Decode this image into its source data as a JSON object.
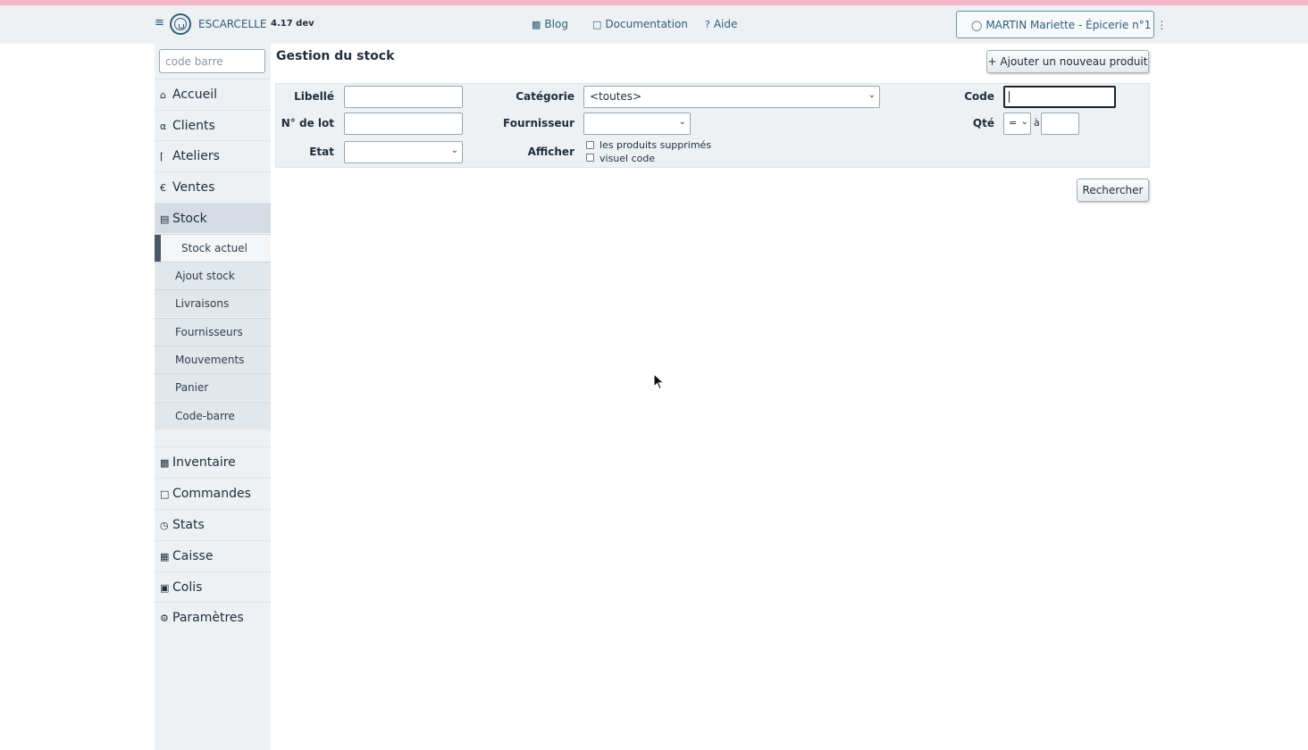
{
  "header": {
    "app_name": "ESCARCELLE",
    "version": "4.17 dev",
    "nav": [
      {
        "icon": "sitemap-icon",
        "label": "Blog"
      },
      {
        "icon": "book-icon",
        "label": "Documentation"
      },
      {
        "icon": "question-icon",
        "label": "Aide"
      }
    ],
    "user_label": "MARTIN Mariette - Épicerie n°1"
  },
  "sidebar": {
    "search_placeholder": "code barre",
    "items": [
      {
        "icon": "home-icon",
        "label": "Accueil"
      },
      {
        "icon": "users-icon",
        "label": "Clients"
      },
      {
        "icon": "tools-icon",
        "label": "Ateliers"
      },
      {
        "icon": "euro-icon",
        "label": "Ventes"
      },
      {
        "icon": "stock-icon",
        "label": "Stock"
      }
    ],
    "sub_items": [
      "Stock actuel",
      "Ajout stock",
      "Livraisons",
      "Fournisseurs",
      "Mouvements",
      "Panier",
      "Code-barre"
    ],
    "items_bottom": [
      {
        "icon": "inventory-icon",
        "label": "Inventaire"
      },
      {
        "icon": "bag-icon",
        "label": "Commandes"
      },
      {
        "icon": "clock-icon",
        "label": "Stats"
      },
      {
        "icon": "calculator-icon",
        "label": "Caisse"
      },
      {
        "icon": "package-icon",
        "label": "Colis"
      },
      {
        "icon": "settings-icon",
        "label": "Paramètres"
      }
    ]
  },
  "main": {
    "title": "Gestion du stock",
    "add_button": "+ Ajouter un nouveau produit",
    "search_button": "Rechercher",
    "filters": {
      "libelle_label": "Libellé",
      "lot_label": "N° de lot",
      "etat_label": "Etat",
      "categorie_label": "Catégorie",
      "categorie_value": "<toutes>",
      "fournisseur_label": "Fournisseur",
      "afficher_label": "Afficher",
      "option_deleted": "les produits supprimés",
      "option_visual": "visuel code",
      "code_label": "Code",
      "qte_label": "Qté",
      "qte_operator": "=",
      "qte_to": "à"
    }
  }
}
